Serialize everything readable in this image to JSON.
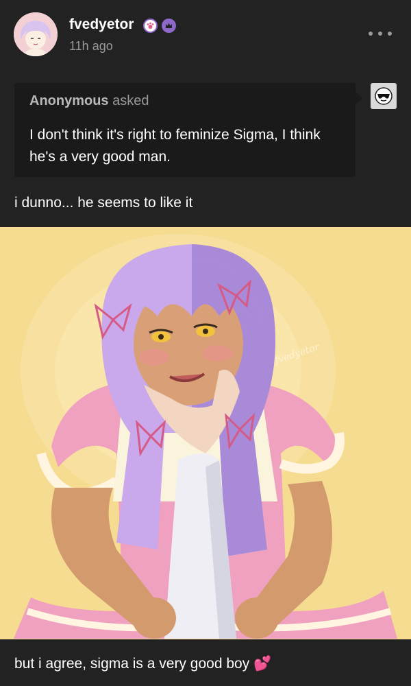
{
  "post": {
    "username": "fvedyetor",
    "timestamp": "11h ago"
  },
  "ask": {
    "asker": "Anonymous",
    "asked_label": "asked",
    "question": "I don't think it's right to feminize Sigma, I think he's a very good man."
  },
  "answer": {
    "text": "i dunno... he seems to like it"
  },
  "artwork": {
    "signature": "fvedyetor"
  },
  "caption": {
    "text": "but i agree, sigma is a very good boy 💕"
  },
  "icons": {
    "avatar": "profile-avatar",
    "badge_1": "paw-badge-icon",
    "badge_2": "crown-badge-icon",
    "more": "more-options-icon",
    "anon": "sunglasses-icon"
  },
  "colors": {
    "background": "#222223",
    "ask_box": "#1a1a1b",
    "art_background": "#f6dc91",
    "accent_purple": "#8c68c9",
    "hair_lilac": "#c9a8ec",
    "dress_pink": "#f0a1c0"
  }
}
